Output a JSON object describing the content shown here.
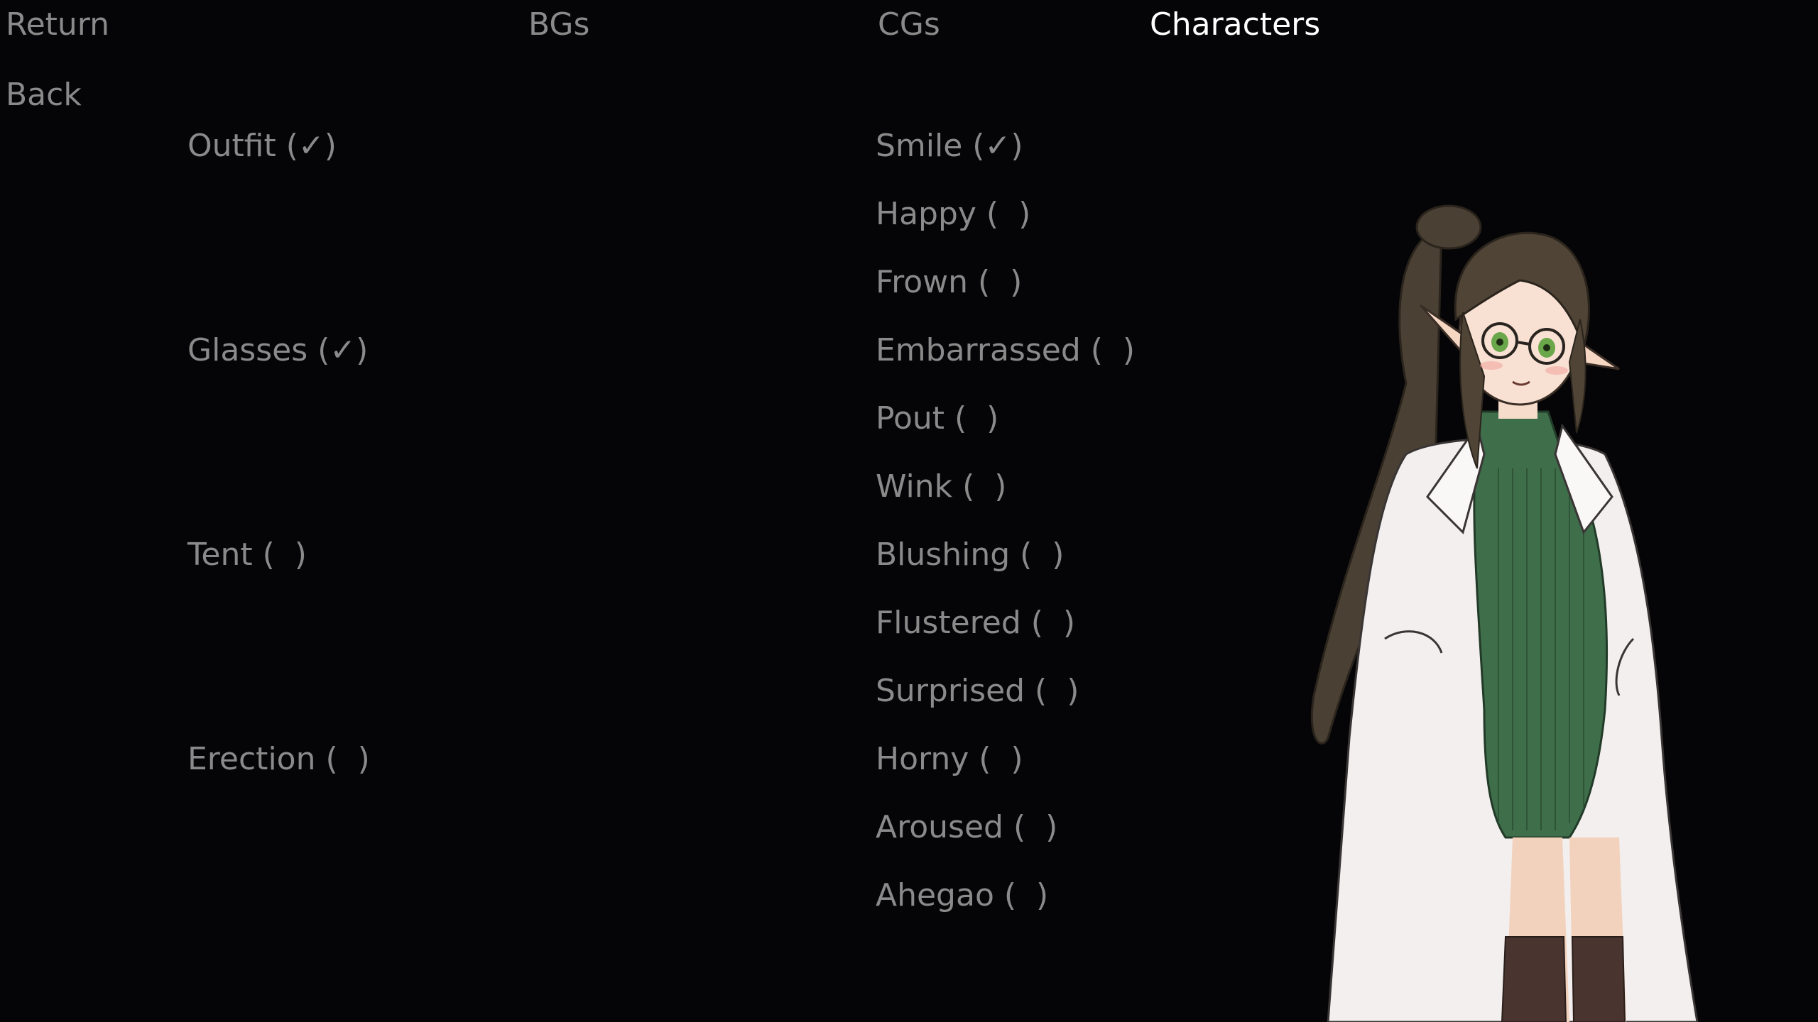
{
  "nav": {
    "return_label": "Return",
    "back_label": "Back",
    "tabs": [
      {
        "label": "BGs",
        "active": false
      },
      {
        "label": "CGs",
        "active": false
      },
      {
        "label": "Characters",
        "active": true
      }
    ]
  },
  "layers": [
    {
      "label": "Outfit (✓)"
    },
    {
      "label": "Glasses (✓)"
    },
    {
      "label": "Tent (  )"
    },
    {
      "label": "Erection (  )"
    }
  ],
  "expressions": [
    {
      "label": "Smile (✓)"
    },
    {
      "label": "Happy (  )"
    },
    {
      "label": "Frown (  )"
    },
    {
      "label": "Embarrassed (  )"
    },
    {
      "label": "Pout (  )"
    },
    {
      "label": "Wink (  )"
    },
    {
      "label": "Blushing (  )"
    },
    {
      "label": "Flustered (  )"
    },
    {
      "label": "Surprised (  )"
    },
    {
      "label": "Horny (  )"
    },
    {
      "label": "Aroused (  )"
    },
    {
      "label": "Ahegao (  )"
    }
  ],
  "colors": {
    "background": "#050406",
    "inactive_text": "#8a8a8a",
    "active_text": "#ffffff"
  }
}
